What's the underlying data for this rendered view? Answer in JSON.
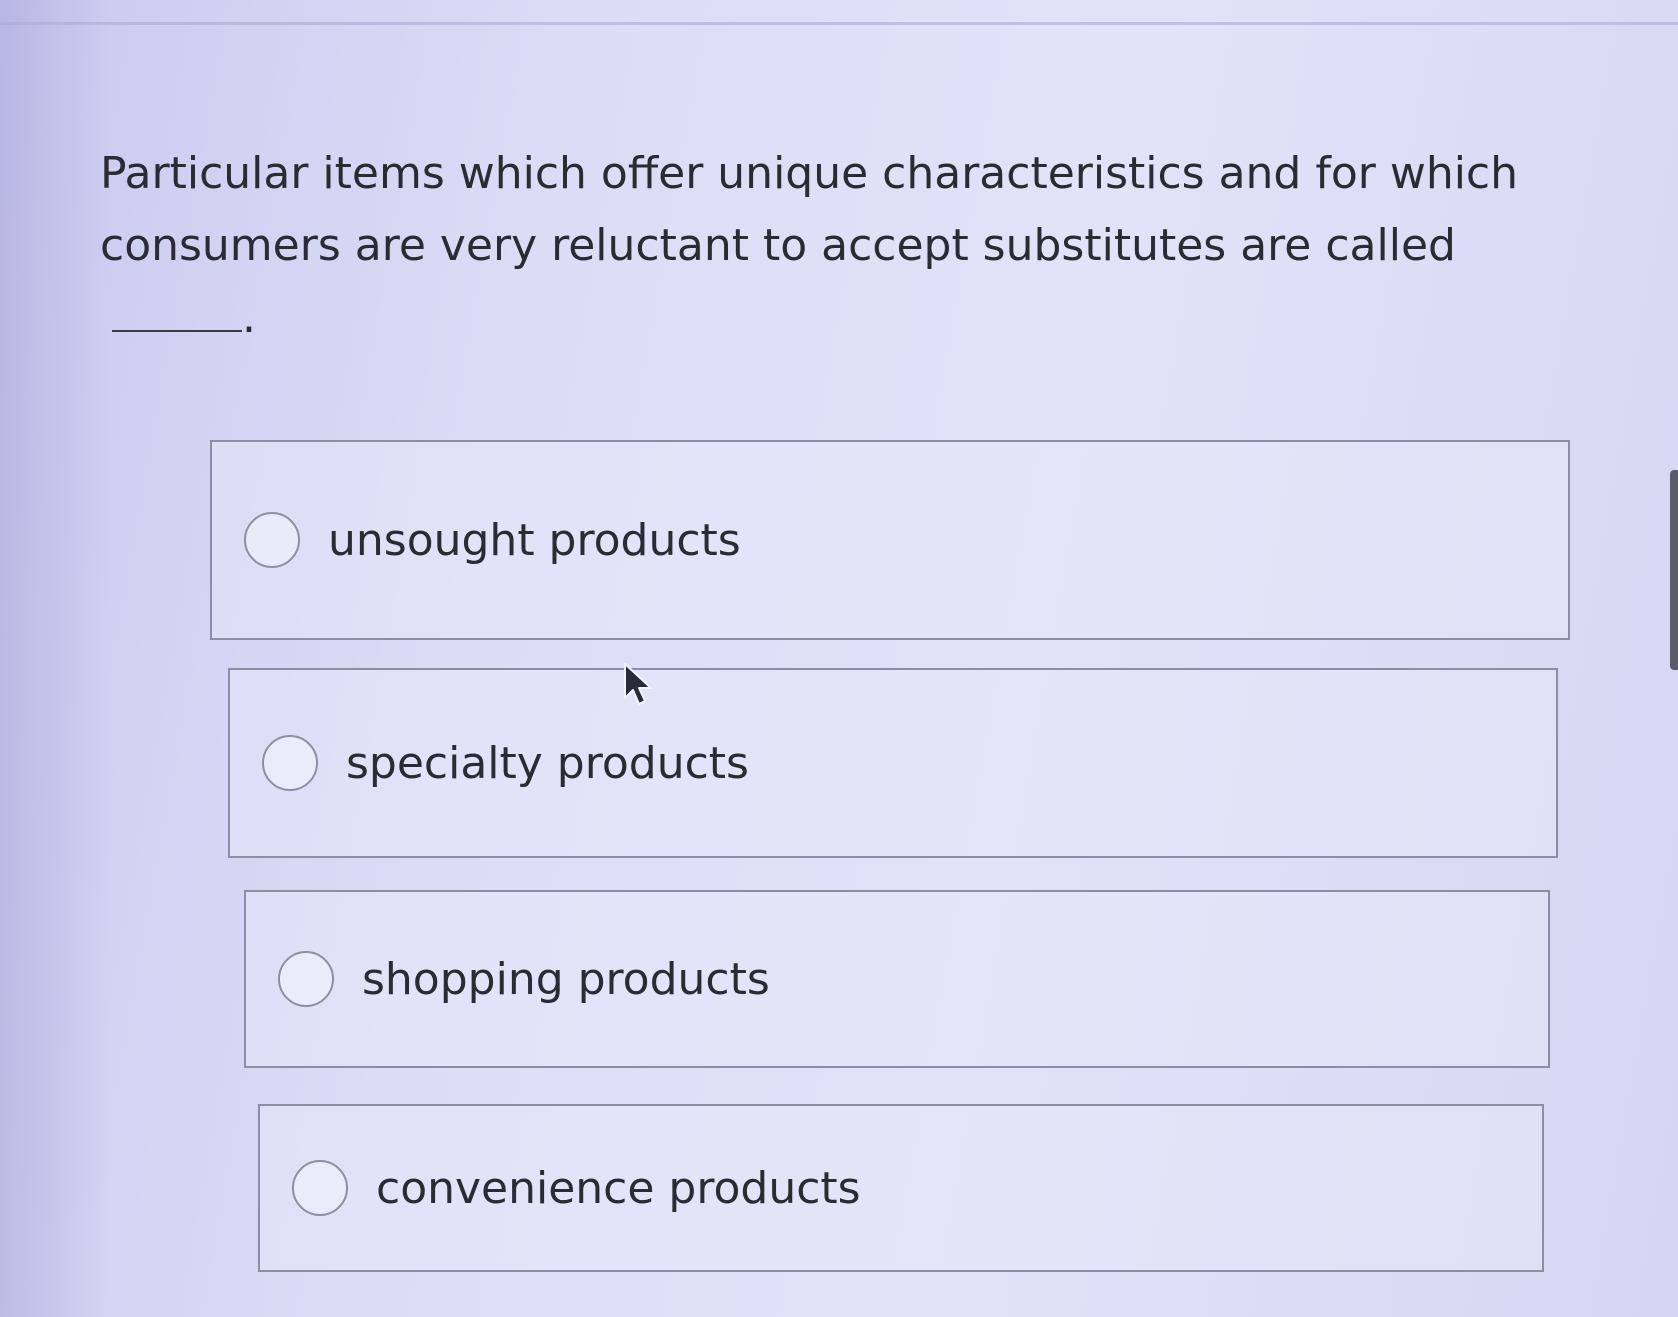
{
  "question": {
    "text": "Particular items which offer unique characteristics and for which consumers are very reluctant to accept substitutes are called",
    "end_punct": "."
  },
  "options": [
    {
      "label": "unsought products",
      "selected": false
    },
    {
      "label": "specialty products",
      "selected": false
    },
    {
      "label": "shopping products",
      "selected": false
    },
    {
      "label": "convenience products",
      "selected": false
    }
  ],
  "icons": {
    "cursor": "mouse-pointer-icon",
    "radio": "radio-circle-icon"
  },
  "colors": {
    "background": "#dcdcf6",
    "option_border": "#8d8da6",
    "text": "#2b2b34"
  }
}
